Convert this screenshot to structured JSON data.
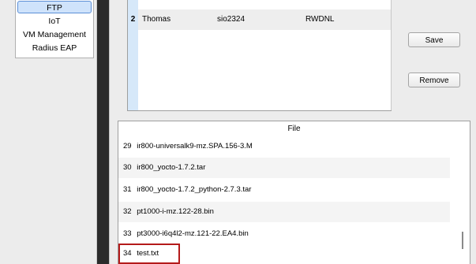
{
  "services": {
    "items": [
      {
        "label": "FTP",
        "selected": true
      },
      {
        "label": "IoT"
      },
      {
        "label": "VM Management"
      },
      {
        "label": "Radius EAP"
      }
    ]
  },
  "user_table": {
    "row": {
      "index": "2",
      "username": "Thomas",
      "password": "sio2324",
      "permission": "RWDNL"
    }
  },
  "buttons": {
    "save_label": "Save",
    "remove_label": "Remove"
  },
  "file_list": {
    "header": "File",
    "rows": [
      {
        "index": "29",
        "name": "ir800-universalk9-mz.SPA.156-3.M"
      },
      {
        "index": "30",
        "name": "ir800_yocto-1.7.2.tar"
      },
      {
        "index": "31",
        "name": "ir800_yocto-1.7.2_python-2.7.3.tar"
      },
      {
        "index": "32",
        "name": "pt1000-i-mz.122-28.bin"
      },
      {
        "index": "33",
        "name": "pt3000-i6q4l2-mz.121-22.EA4.bin"
      },
      {
        "index": "34",
        "name": "test.txt"
      }
    ]
  },
  "colors": {
    "selected_bg": "#cfe3fb",
    "highlight_border": "#b41a1a"
  }
}
